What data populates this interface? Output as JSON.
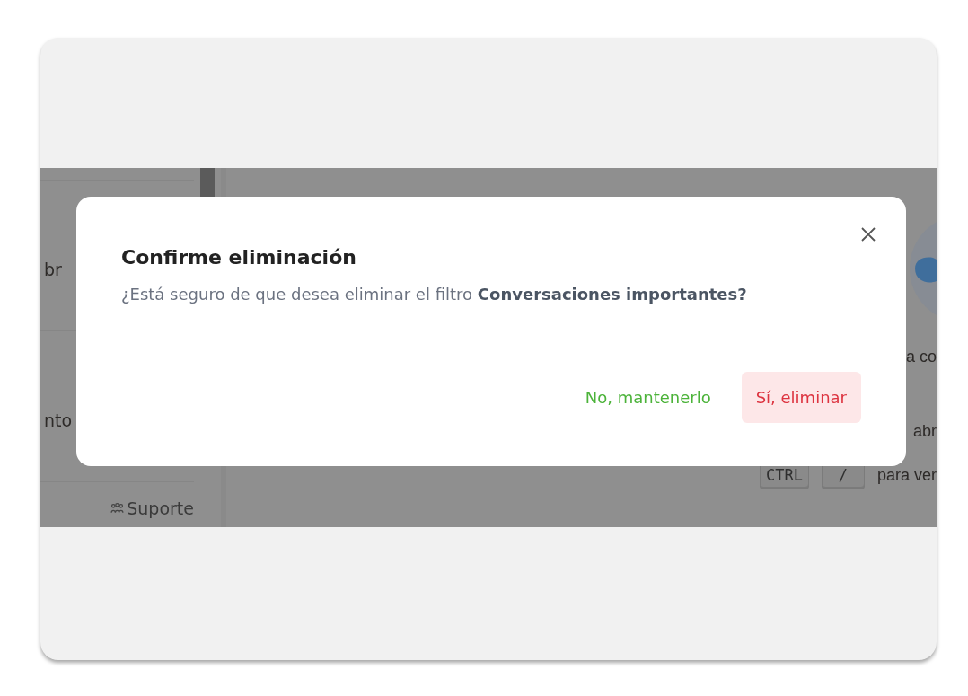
{
  "background_app": {
    "sidebar": {
      "items": [
        {
          "label": "br"
        },
        {
          "label": "nto"
        }
      ],
      "support_link": "Suporte"
    },
    "main": {
      "lines": [
        "a co",
        "abr"
      ],
      "shortcut": {
        "keys": [
          "CTRL",
          "/"
        ],
        "text": "para ver"
      }
    }
  },
  "dialog": {
    "title": "Confirme eliminación",
    "message": "¿Está seguro de que desea eliminar el filtro **Conversaciones importantes?**",
    "buttons": [
      {
        "label": "No, mantenerlo",
        "kind": "secondary"
      },
      {
        "label": "Sí, eliminar",
        "kind": "danger"
      }
    ]
  }
}
